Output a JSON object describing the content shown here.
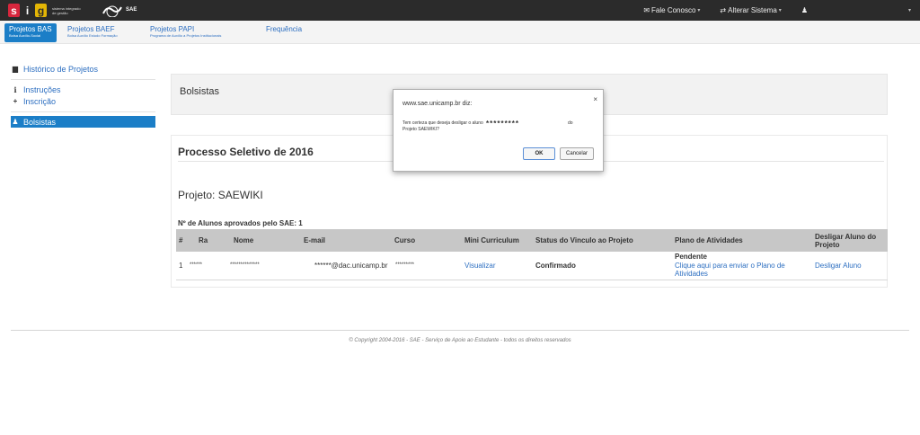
{
  "topbar": {
    "sig_logo": {
      "letters": [
        "s",
        "i",
        "g"
      ],
      "subtitle": "sistema integrado de gestão"
    },
    "sae_logo": {
      "text": "SAE"
    },
    "menu": [
      {
        "label": "Fale Conosco",
        "icon": "envelope-icon"
      },
      {
        "label": "Alterar Sistema",
        "icon": "swap-icon"
      },
      {
        "label": "",
        "icon": "user-icon"
      }
    ]
  },
  "subnav": {
    "tabs": [
      {
        "title": "Projetos BAS",
        "subtitle": "Bolsa Auxílio-Social",
        "active": true
      },
      {
        "title": "Projetos BAEF",
        "subtitle": "Bolsa Auxílio Estudo Formação",
        "active": false
      },
      {
        "title": "Projetos PAPI",
        "subtitle": "Programa de Auxílio a Projetos Institucionais",
        "active": false
      },
      {
        "title": "Frequência",
        "subtitle": "",
        "active": false
      }
    ]
  },
  "sidebar": {
    "historico": "Histórico de Projetos",
    "instrucoes": "Instruções",
    "inscricao": "Inscrição",
    "bolsistas": "Bolsistas"
  },
  "main": {
    "header_title": "Bolsistas",
    "process_title": "Processo Seletivo de 2016",
    "project_label": "Projeto: SAEWIKI",
    "approved_label": "Nº de Alunos aprovados pelo SAE:",
    "approved_count": "1",
    "table": {
      "headers": [
        "#",
        "Ra",
        "Nome",
        "E-mail",
        "Curso",
        "Mini Curriculum",
        "Status do Vinculo ao Projeto",
        "Plano de Atividades",
        "Desligar Aluno do Projeto"
      ],
      "rows": [
        {
          "index": "1",
          "ra": "******",
          "nome": "**************",
          "email": "******@dac.unicamp.br",
          "curso": "*********",
          "mini_curriculum": "Visualizar",
          "status": "Confirmado",
          "plano_status": "Pendente",
          "plano_link": "Clique aqui para enviar o Plano de Atividades",
          "desligar": "Desligar Aluno"
        }
      ]
    }
  },
  "footer": {
    "text": "© Copyright 2004-2016 - SAE - Serviço de Apoio ao Estudante - todos os direitos reservados"
  },
  "dialog": {
    "title": "www.sae.unicamp.br diz:",
    "message": "Tem certeza que deseja desligar o aluno",
    "masked": "*********",
    "message_tail": "do",
    "message_line2": "Projeto SAEWIKI?",
    "ok": "OK",
    "cancel": "Cancelar",
    "close": "×"
  },
  "colors": {
    "accent": "#1b7ec7",
    "link": "#2d6fc1",
    "topbar": "#2b2b2b"
  }
}
